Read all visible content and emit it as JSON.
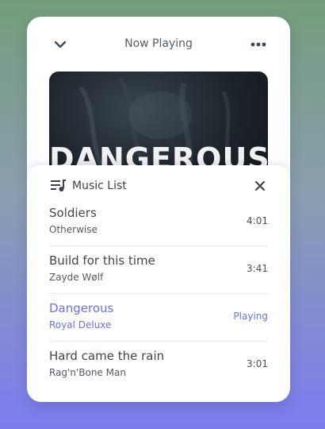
{
  "player": {
    "header_title": "Now Playing",
    "cover_text": "DANGEROUS"
  },
  "music_list": {
    "title": "Music List",
    "tracks": [
      {
        "title": "Soldiers",
        "artist": "Otherwise",
        "duration": "4:01",
        "active": false
      },
      {
        "title": "Build for this time",
        "artist": "Zayde Wølf",
        "duration": "3:41",
        "active": false
      },
      {
        "title": "Dangerous",
        "artist": "Royal Deluxe",
        "duration": "Playing",
        "active": true
      },
      {
        "title": "Hard came the rain",
        "artist": "Rag'n'Bone Man",
        "duration": "3:01",
        "active": false
      }
    ]
  },
  "icons": {
    "collapse": "chevron-down-icon",
    "more": "more-horizontal-icon",
    "queue": "playlist-icon",
    "close": "close-icon"
  },
  "colors": {
    "accent": "#6a70ee",
    "text": "#41464d",
    "background_top": "#749c7c",
    "background_bottom": "#7b7cf0"
  }
}
